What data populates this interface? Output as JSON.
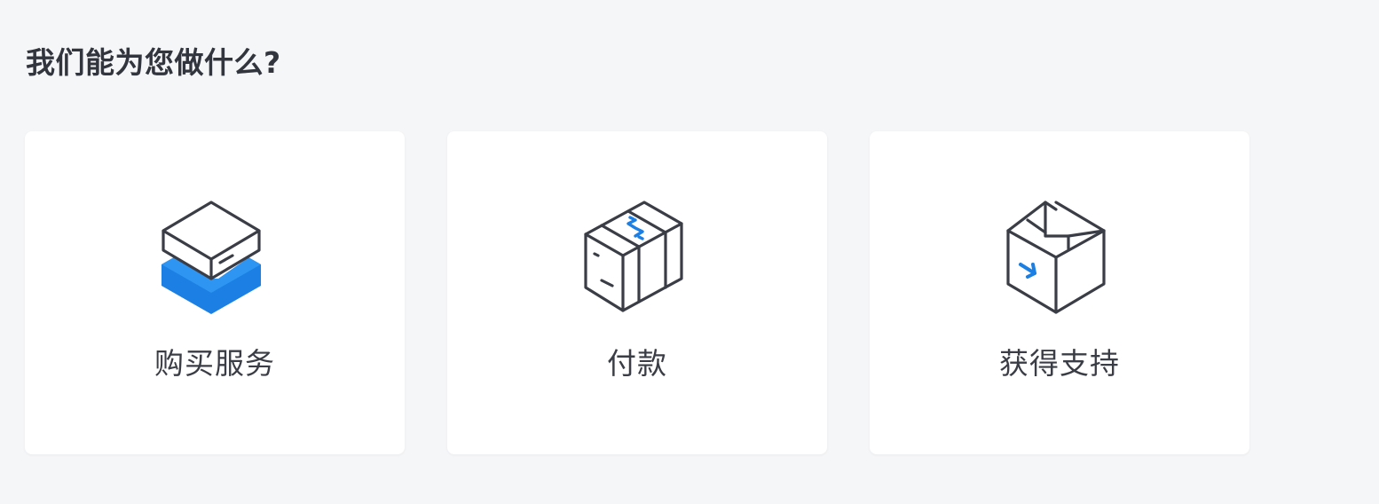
{
  "page": {
    "title": "我们能为您做什么?"
  },
  "cards": [
    {
      "label": "购买服务",
      "icon": "server-stack-icon"
    },
    {
      "label": "付款",
      "icon": "dollar-box-icon"
    },
    {
      "label": "获得支持",
      "icon": "open-box-arrow-icon"
    }
  ],
  "colors": {
    "background": "#f5f6f8",
    "card": "#ffffff",
    "accent_blue": "#1b7fe3",
    "icon_stroke": "#3a3d45",
    "text": "#32353d"
  }
}
